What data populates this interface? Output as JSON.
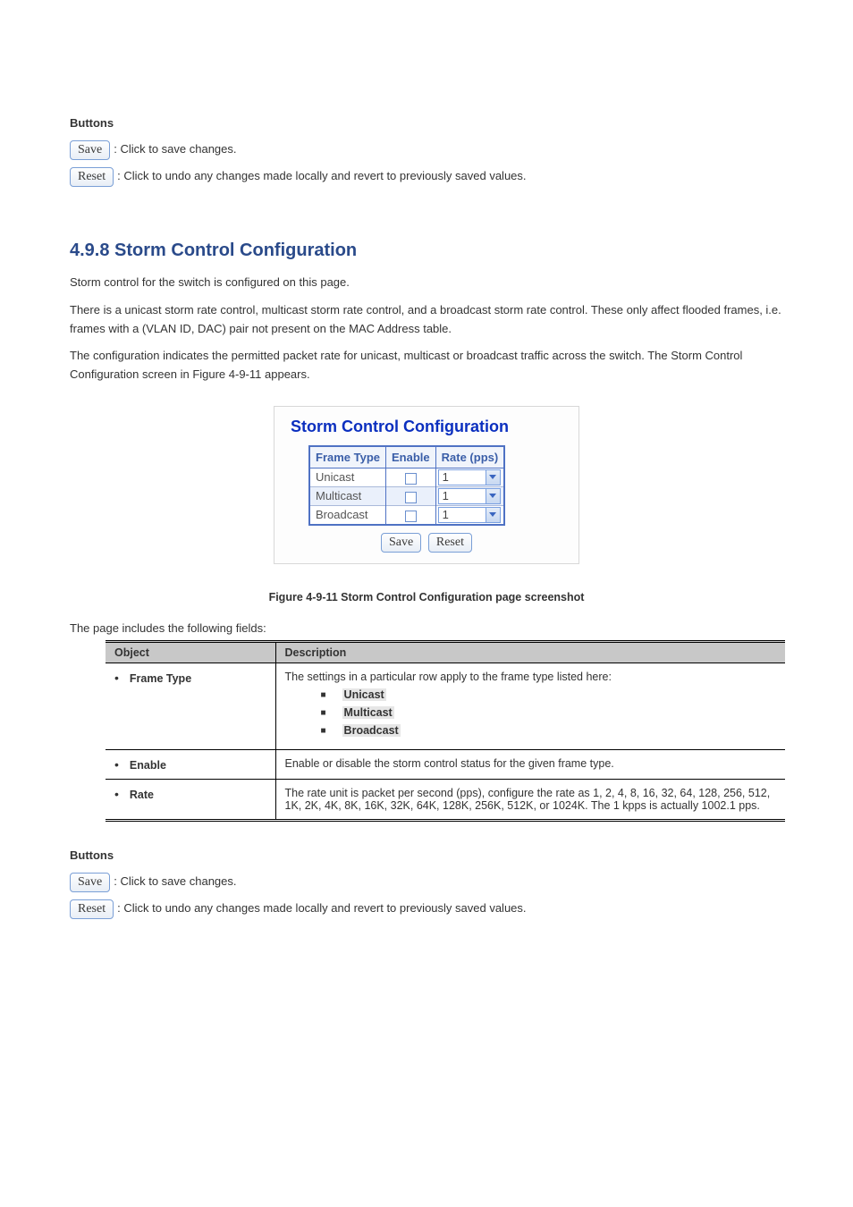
{
  "buttons": {
    "save_label": "Save",
    "save_desc": ": Click to save changes.",
    "reset_label": "Reset",
    "reset_desc": ": Click to undo any changes made locally and revert to previously saved values."
  },
  "section": {
    "number": "4.9.8",
    "title": "Storm Control Configuration",
    "intro": "Storm control for the switch is configured on this page. ",
    "p1": "There is a unicast storm rate control, multicast storm rate control, and a broadcast storm rate control. These only affect flooded frames, i.e. frames with a (VLAN ID, DAC) pair not present on the MAC Address table. ",
    "p2_pre": "The configuration indicates the permitted packet rate for unicast, multicast or broadcast traffic across the switch. The Storm Control Configuration screen in ",
    "p2_figref": "Figure 4-9-11",
    "p2_post": " appears. "
  },
  "ui_panel": {
    "title": "Storm Control Configuration",
    "headers": {
      "frame_type": "Frame Type",
      "enable": "Enable",
      "rate": "Rate (pps)"
    },
    "rows": [
      {
        "label": "Unicast",
        "rate": "1"
      },
      {
        "label": "Multicast",
        "rate": "1"
      },
      {
        "label": "Broadcast",
        "rate": "1"
      }
    ]
  },
  "figure_caption_pre": "Figure 4-9-11",
  "figure_caption_post": " Storm Control Configuration page screenshot ",
  "desc_intro": "The page includes the following fields: ",
  "desc_table": {
    "head_obj": "Object",
    "head_desc": "Description",
    "rows": [
      {
        "obj": "Frame Type",
        "desc": "The settings in a particular row apply to the frame type listed here: ",
        "bullets": [
          "Unicast",
          "Multicast",
          "Broadcast"
        ]
      },
      {
        "obj": "Enable",
        "desc": "Enable or disable the storm control status for the given frame type. "
      },
      {
        "obj": "Rate",
        "desc": "The rate unit is packet per second (pps), configure the rate as 1, 2, 4, 8, 16, 32, 64, 128, 256, 512, 1K, 2K, 4K, 8K, 16K, 32K, 64K, 128K, 256K, 512K, or 1024K. The 1 kpps is actually 1002.1 pps."
      }
    ]
  },
  "section_buttons_label": "Buttons"
}
